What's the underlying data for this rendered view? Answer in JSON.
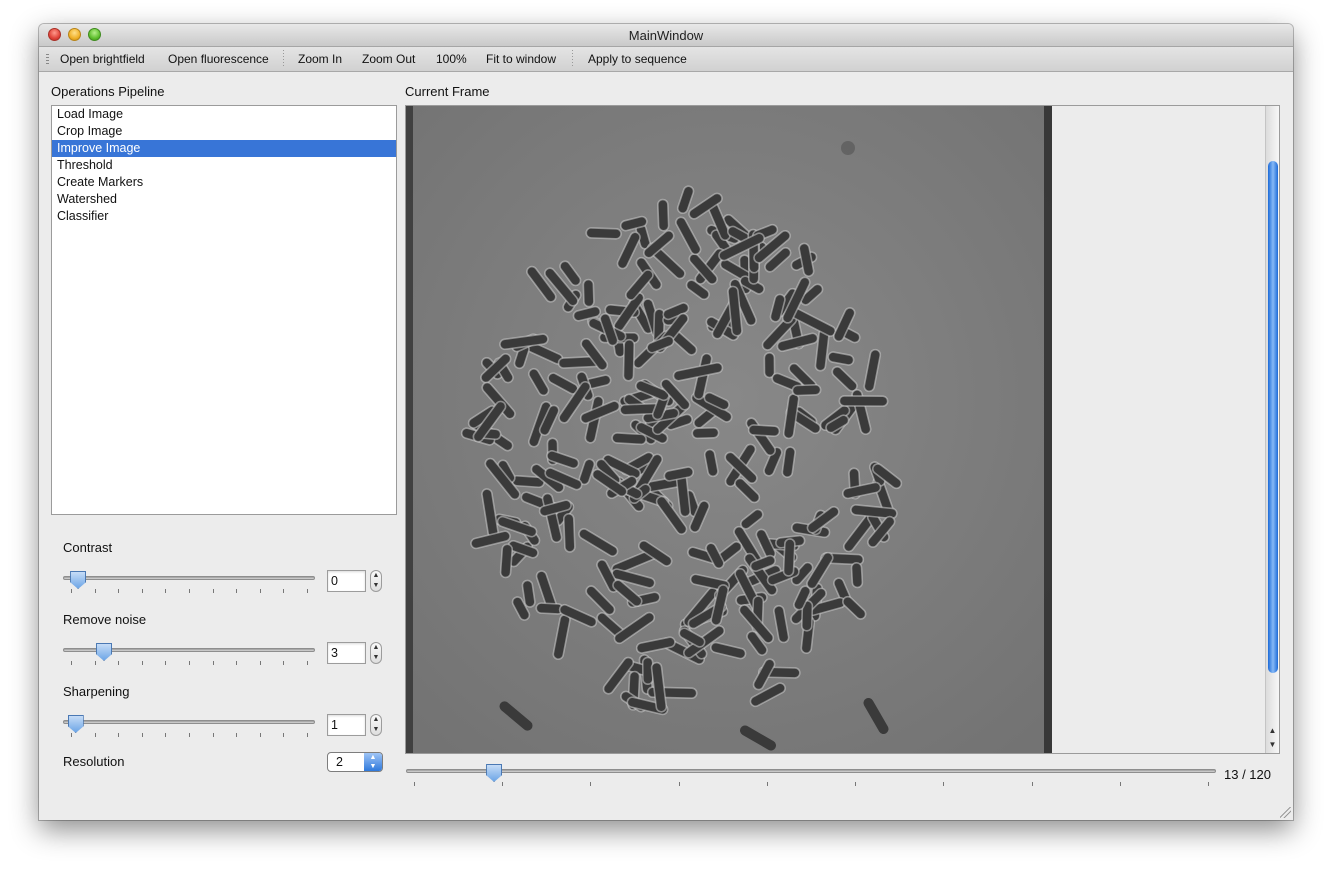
{
  "window": {
    "title": "MainWindow"
  },
  "toolbar": {
    "open_brightfield": "Open brightfield",
    "open_fluorescence": "Open fluorescence",
    "zoom_in": "Zoom In",
    "zoom_out": "Zoom Out",
    "zoom_100": "100%",
    "fit_to_window": "Fit to window",
    "apply_to_sequence": "Apply to sequence"
  },
  "pipeline": {
    "label": "Operations Pipeline",
    "items": [
      {
        "label": "Load Image",
        "selected": false
      },
      {
        "label": "Crop Image",
        "selected": false
      },
      {
        "label": "Improve Image",
        "selected": true
      },
      {
        "label": "Threshold",
        "selected": false
      },
      {
        "label": "Create Markers",
        "selected": false
      },
      {
        "label": "Watershed",
        "selected": false
      },
      {
        "label": "Classifier",
        "selected": false
      }
    ]
  },
  "controls": {
    "contrast": {
      "label": "Contrast",
      "value": "0",
      "level": 0.03
    },
    "remove_noise": {
      "label": "Remove noise",
      "value": "3",
      "level": 0.14
    },
    "sharpening": {
      "label": "Sharpening",
      "value": "1",
      "level": 0.02
    },
    "resolution": {
      "label": "Resolution",
      "value": "2"
    }
  },
  "viewer": {
    "label": "Current Frame",
    "frame_current": 13,
    "frame_total": 120,
    "frame_text": "13 / 120",
    "image_description_icon": "bacteria-microscopy-image"
  },
  "colors": {
    "selection": "#3875d7",
    "slider_knob": "#6ea6e6",
    "image_background": "#7e7e7e"
  }
}
